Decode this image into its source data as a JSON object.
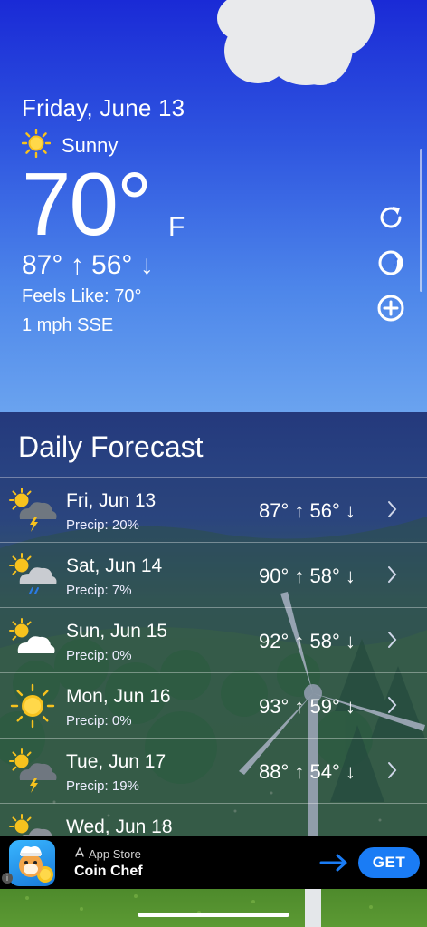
{
  "current": {
    "date": "Friday, June 13",
    "condition": "Sunny",
    "condition_icon": "sun-icon",
    "temperature": "70°",
    "unit": "F",
    "high_low": "87° ↑  56° ↓",
    "feels_like": "Feels Like: 70°",
    "wind": "1 mph SSE"
  },
  "actions": {
    "refresh_icon": "refresh-icon",
    "theme_icon": "moon-phase-icon",
    "add_icon": "add-circle-icon"
  },
  "daily_forecast": {
    "title": "Daily Forecast",
    "days": [
      {
        "day": "Fri, Jun 13",
        "precip": "Precip: 20%",
        "hilo": "87° ↑  56° ↓",
        "icon": "sun-storm-cloud-icon"
      },
      {
        "day": "Sat, Jun 14",
        "precip": "Precip: 7%",
        "hilo": "90° ↑  58° ↓",
        "icon": "sun-rain-cloud-icon"
      },
      {
        "day": "Sun, Jun 15",
        "precip": "Precip: 0%",
        "hilo": "92° ↑  58° ↓",
        "icon": "partly-cloudy-icon"
      },
      {
        "day": "Mon, Jun 16",
        "precip": "Precip: 0%",
        "hilo": "93° ↑  59° ↓",
        "icon": "sun-icon"
      },
      {
        "day": "Tue, Jun 17",
        "precip": "Precip: 19%",
        "hilo": "88° ↑  54° ↓",
        "icon": "sun-storm-cloud-icon"
      },
      {
        "day": "Wed, Jun 18",
        "precip": "",
        "hilo": "",
        "icon": "sun-cloud-icon"
      }
    ]
  },
  "ad": {
    "store_label": "App Store",
    "app_name": "Coin Chef",
    "button_label": "GET",
    "info_label": "i"
  },
  "colors": {
    "ad_button": "#1a7cf5",
    "sun": "#f7c21e"
  }
}
